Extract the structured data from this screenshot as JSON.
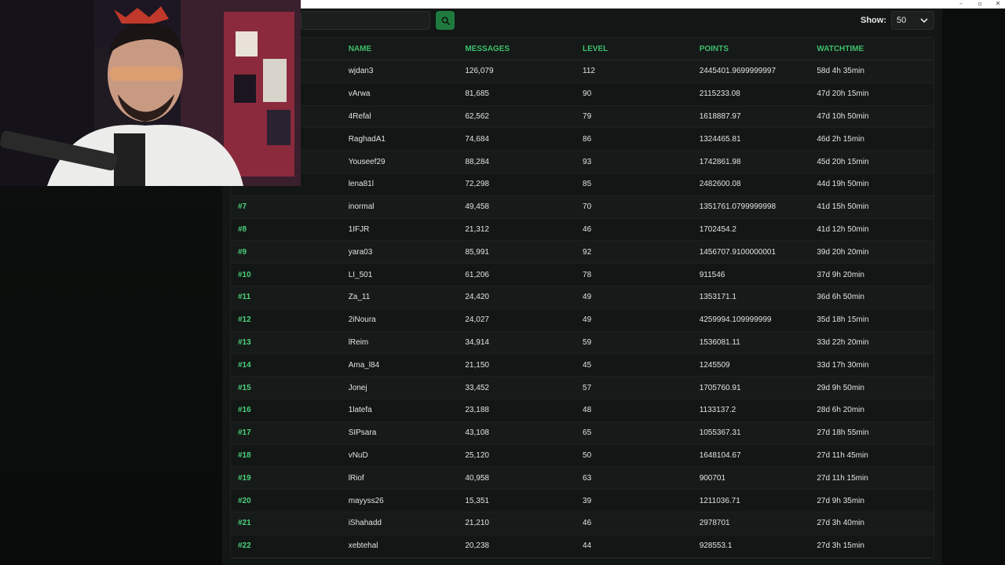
{
  "window": {
    "minimize": "–",
    "restore": "▫",
    "close": "✕"
  },
  "search": {
    "value": "",
    "placeholder": ""
  },
  "show": {
    "label": "Show:",
    "value": "50"
  },
  "table": {
    "headers": [
      "",
      "NAME",
      "MESSAGES",
      "LEVEL",
      "POINTS",
      "WATCHTIME"
    ],
    "rows": [
      {
        "rank": "",
        "name": "wjdan3",
        "messages": "126,079",
        "level": "112",
        "points": "2445401.9699999997",
        "watchtime": "58d 4h 35min"
      },
      {
        "rank": "",
        "name": "vArwa",
        "messages": "81,685",
        "level": "90",
        "points": "2115233.08",
        "watchtime": "47d 20h 15min"
      },
      {
        "rank": "",
        "name": "4Refal",
        "messages": "62,562",
        "level": "79",
        "points": "1618887.97",
        "watchtime": "47d 10h 50min"
      },
      {
        "rank": "",
        "name": "RaghadA1",
        "messages": "74,684",
        "level": "86",
        "points": "1324465.81",
        "watchtime": "46d 2h 15min"
      },
      {
        "rank": "",
        "name": "Youseef29",
        "messages": "88,284",
        "level": "93",
        "points": "1742861.98",
        "watchtime": "45d 20h 15min"
      },
      {
        "rank": "",
        "name": "lena81l",
        "messages": "72,298",
        "level": "85",
        "points": "2482600.08",
        "watchtime": "44d 19h 50min"
      },
      {
        "rank": "#7",
        "name": "inormal",
        "messages": "49,458",
        "level": "70",
        "points": "1351761.0799999998",
        "watchtime": "41d 15h 50min"
      },
      {
        "rank": "#8",
        "name": "1IFJR",
        "messages": "21,312",
        "level": "46",
        "points": "1702454.2",
        "watchtime": "41d 12h 50min"
      },
      {
        "rank": "#9",
        "name": "yara03",
        "messages": "85,991",
        "level": "92",
        "points": "1456707.9100000001",
        "watchtime": "39d 20h 20min"
      },
      {
        "rank": "#10",
        "name": "LI_501",
        "messages": "61,206",
        "level": "78",
        "points": "911546",
        "watchtime": "37d 9h 20min"
      },
      {
        "rank": "#11",
        "name": "Za_11",
        "messages": "24,420",
        "level": "49",
        "points": "1353171.1",
        "watchtime": "36d 6h 50min"
      },
      {
        "rank": "#12",
        "name": "2iNoura",
        "messages": "24,027",
        "level": "49",
        "points": "4259994.109999999",
        "watchtime": "35d 18h 15min"
      },
      {
        "rank": "#13",
        "name": "lReim",
        "messages": "34,914",
        "level": "59",
        "points": "1536081.11",
        "watchtime": "33d 22h 20min"
      },
      {
        "rank": "#14",
        "name": "Ama_l84",
        "messages": "21,150",
        "level": "45",
        "points": "1245509",
        "watchtime": "33d 17h 30min"
      },
      {
        "rank": "#15",
        "name": "Jonej",
        "messages": "33,452",
        "level": "57",
        "points": "1705760.91",
        "watchtime": "29d 9h 50min"
      },
      {
        "rank": "#16",
        "name": "1latefa",
        "messages": "23,188",
        "level": "48",
        "points": "1133137.2",
        "watchtime": "28d 6h 20min"
      },
      {
        "rank": "#17",
        "name": "SIPsara",
        "messages": "43,108",
        "level": "65",
        "points": "1055367.31",
        "watchtime": "27d 18h 55min"
      },
      {
        "rank": "#18",
        "name": "vNuD",
        "messages": "25,120",
        "level": "50",
        "points": "1648104.67",
        "watchtime": "27d 11h 45min"
      },
      {
        "rank": "#19",
        "name": "lRiof",
        "messages": "40,958",
        "level": "63",
        "points": "900701",
        "watchtime": "27d 11h 15min"
      },
      {
        "rank": "#20",
        "name": "mayyss26",
        "messages": "15,351",
        "level": "39",
        "points": "1211036.71",
        "watchtime": "27d 9h 35min"
      },
      {
        "rank": "#21",
        "name": "iShahadd",
        "messages": "21,210",
        "level": "46",
        "points": "2978701",
        "watchtime": "27d 3h 40min"
      },
      {
        "rank": "#22",
        "name": "xebtehal",
        "messages": "20,238",
        "level": "44",
        "points": "928553.1",
        "watchtime": "27d 3h 15min"
      }
    ]
  },
  "colors": {
    "accent": "#3fbf6c",
    "rank": "#4cd07d",
    "search_button": "#1f7a3f"
  },
  "icons": {
    "search": "search-icon",
    "chevron": "chevron-down-icon"
  }
}
